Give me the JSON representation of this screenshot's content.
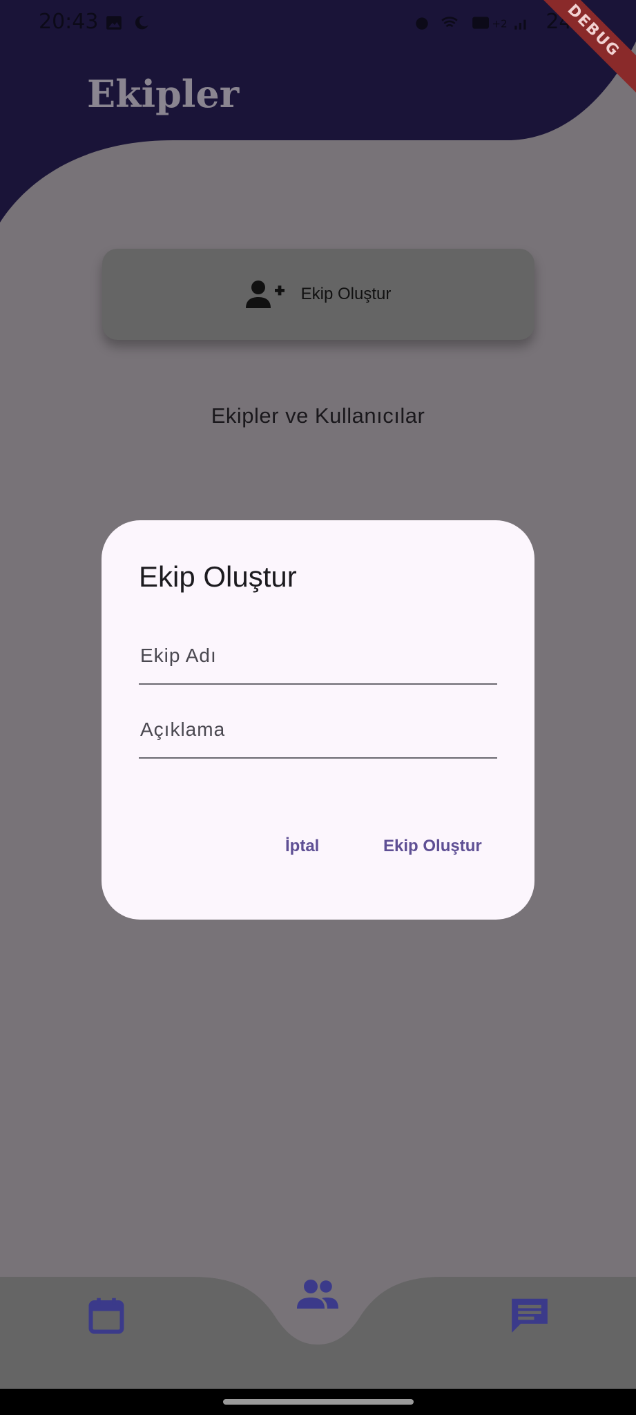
{
  "status_bar": {
    "time": "20:43",
    "battery": "24%"
  },
  "header": {
    "title": "Ekipler",
    "debug_banner": "DEBUG"
  },
  "main": {
    "create_team_button": "Ekip Oluştur",
    "section_title": "Ekipler ve Kullanıcılar"
  },
  "dialog": {
    "title": "Ekip Oluştur",
    "fields": [
      {
        "label": "Ekip Adı",
        "value": ""
      },
      {
        "label": "Açıklama",
        "value": ""
      }
    ],
    "cancel_label": "İptal",
    "confirm_label": "Ekip Oluştur"
  },
  "bottom_nav": {
    "items": [
      {
        "icon": "calendar-icon",
        "active": false
      },
      {
        "icon": "group-icon",
        "active": true
      },
      {
        "icon": "chat-icon",
        "active": false
      }
    ]
  },
  "colors": {
    "header_bg": "#1a1438",
    "scrim_bg": "#787378",
    "dialog_bg": "#fcf6fd",
    "accent": "#5e4f94",
    "nav_icon": "#3b3a8a"
  }
}
